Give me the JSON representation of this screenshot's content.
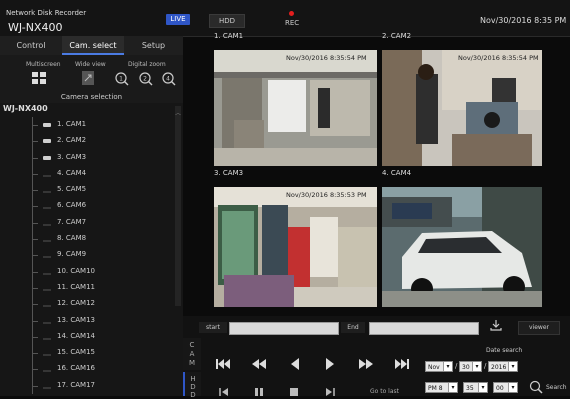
{
  "header": {
    "subtitle": "Network Disk Recorder",
    "model": "WJ-NX400",
    "live_label": "LIVE",
    "hdd_label": "HDD",
    "rec_label": "REC",
    "datetime": "Nov/30/2016  8:35  PM"
  },
  "tabs": [
    {
      "label": "Control"
    },
    {
      "label": "Cam. select"
    },
    {
      "label": "Setup"
    }
  ],
  "view_controls": {
    "multiscreen_label": "Multiscreen",
    "wideview_label": "Wide view",
    "digitalzoom_label": "Digital zoom"
  },
  "camera_selection": {
    "title": "Camera selection",
    "root": "WJ-NX400",
    "cameras": [
      {
        "label": "1. CAM1"
      },
      {
        "label": "2. CAM2"
      },
      {
        "label": "3. CAM3"
      },
      {
        "label": "4. CAM4"
      },
      {
        "label": "5. CAM5"
      },
      {
        "label": "6. CAM6"
      },
      {
        "label": "7. CAM7"
      },
      {
        "label": "8. CAM8"
      },
      {
        "label": "9. CAM9"
      },
      {
        "label": "10. CAM10"
      },
      {
        "label": "11. CAM11"
      },
      {
        "label": "12. CAM12"
      },
      {
        "label": "13. CAM13"
      },
      {
        "label": "14. CAM14"
      },
      {
        "label": "15. CAM15"
      },
      {
        "label": "16. CAM16"
      },
      {
        "label": "17. CAM17"
      }
    ]
  },
  "panels": [
    {
      "title": "1. CAM1",
      "timestamp": "Nov/30/2016  8:35:54 PM"
    },
    {
      "title": "2. CAM2",
      "timestamp": "Nov/30/2016  8:35:54 PM"
    },
    {
      "title": "3. CAM3",
      "timestamp": "Nov/30/2016  8:35:53 PM"
    },
    {
      "title": "4. CAM4",
      "timestamp": ""
    }
  ],
  "playback": {
    "start_label": "start",
    "end_label": "End",
    "viewer_label": "viewer",
    "cam_tab": "C\nA\nM",
    "hdd_tab": "H\nD\nD",
    "goto_last": "Go to last",
    "date_search_label": "Date search",
    "search_label": "Search",
    "month": "Nov",
    "day": "30",
    "year": "2016",
    "hour": "PM 8",
    "minute": "35",
    "second": "00"
  }
}
